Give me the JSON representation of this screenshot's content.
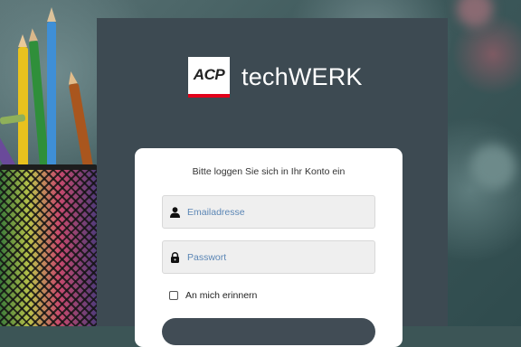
{
  "brand": {
    "badge_text": "ACP",
    "name": "techWERK",
    "accent_color": "#e2001a"
  },
  "login": {
    "title": "Bitte loggen Sie sich in Ihr Konto ein",
    "email_placeholder": "Emailadresse",
    "email_icon": "user-icon",
    "password_placeholder": "Passwort",
    "password_icon": "lock-icon",
    "remember_label": "An mich erinnern",
    "remember_checked": false
  },
  "colors": {
    "panel": "#3d4a52",
    "button": "#414c55",
    "placeholder": "#5b86b5"
  }
}
